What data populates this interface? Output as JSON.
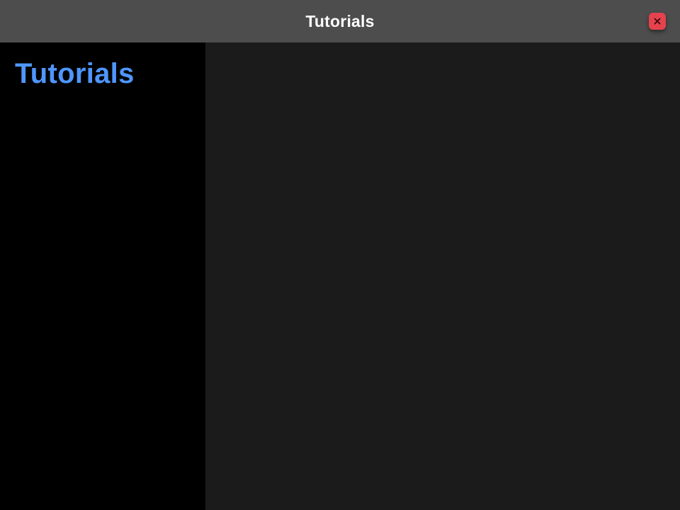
{
  "window": {
    "title": "Tutorials"
  },
  "titlebar": {
    "close_icon": "close-icon",
    "close_color": "#e5424d"
  },
  "sidebar": {
    "heading": "Tutorials",
    "heading_color": "#4f96ff"
  },
  "colors": {
    "titlebar_bg": "#4d4d4d",
    "sidebar_bg": "#000000",
    "content_bg": "#1b1b1b"
  }
}
